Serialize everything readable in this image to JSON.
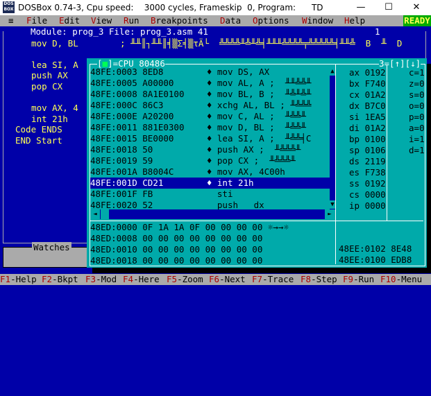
{
  "window": {
    "title": "DOSBox 0.74-3, Cpu speed:    3000 cycles, Frameskip  0, Program:      TD",
    "icon_text": "DOS BOX",
    "minimize": "—",
    "maximize": "☐",
    "close": "✕"
  },
  "menubar": {
    "system": "≡",
    "items": [
      {
        "hk": "F",
        "rest": "ile"
      },
      {
        "hk": "E",
        "rest": "dit"
      },
      {
        "hk": "V",
        "rest": "iew"
      },
      {
        "hk": "R",
        "rest": "un"
      },
      {
        "hk": "B",
        "rest": "reakpoints"
      },
      {
        "hk": "D",
        "rest": "ata"
      },
      {
        "hk": "O",
        "rest": "ptions"
      },
      {
        "hk": "W",
        "rest": "indow"
      },
      {
        "hk": "H",
        "rest": "elp"
      }
    ],
    "status": "READY"
  },
  "module": {
    "title": "Module: prog_3 File: prog_3.asm 41",
    "number": "1",
    "lines": [
      "  mov D, BL        ; ╨╨║┐╨╨║╡▒Σ╡▒τÄ└  ╩╩╩╩╨╩╨╩╡╨╨╨╩╩╩╩╤╩╩╩╩╩╡╨╨╩  B  ╨  D",
      "",
      "  lea SI, A",
      "  push AX",
      "  pop CX",
      "",
      "  mov AX, 4",
      "  int 21h",
      "Code ENDS",
      "END Start"
    ]
  },
  "watches": {
    "title": "Watches"
  },
  "cpu": {
    "title": "CPU 80486",
    "close_glyph": "■",
    "window_number": "3",
    "resize_glyphs": "=[↑][↓]",
    "disasm": [
      {
        "addr": "48FE:0003",
        "bytes": "8ED8",
        "instr": "mov DS, AX"
      },
      {
        "addr": "48FE:0005",
        "bytes": "A00000",
        "instr": "mov AL, A ;  ╨╨╩╩╨"
      },
      {
        "addr": "48FE:0008",
        "bytes": "8A1E0100",
        "instr": "mov BL, B ;  ╨╩╨╩╨"
      },
      {
        "addr": "48FE:000C",
        "bytes": "86C3",
        "instr": "xchg AL, BL ; ╨╩╩╩"
      },
      {
        "addr": "48FE:000E",
        "bytes": "A20200",
        "instr": "mov C, AL ;  ╨╩╩╨"
      },
      {
        "addr": "48FE:0011",
        "bytes": "881E0300",
        "instr": "mov D, BL ;  ╨╩╩╨"
      },
      {
        "addr": "48FE:0015",
        "bytes": "BE0000",
        "instr": "lea SI, A ;  ╨╩╩╡C"
      },
      {
        "addr": "48FE:0018",
        "bytes": "50",
        "instr": "push AX ;  ╨╩╩╩╨"
      },
      {
        "addr": "48FE:0019",
        "bytes": "59",
        "instr": "pop CX ;  ╨╩╩╩╨"
      },
      {
        "addr": "48FE:001A",
        "bytes": "B8004C",
        "instr": "mov AX, 4C00h"
      },
      {
        "addr": "48FE:001D",
        "bytes": "CD21",
        "instr": "int 21h",
        "selected": true
      },
      {
        "addr": "48FE:001F",
        "bytes": "FB",
        "instr": "sti",
        "plain": true
      },
      {
        "addr": "48FE:0020",
        "bytes": "52",
        "instr": "push   dx",
        "plain": true
      }
    ],
    "registers": [
      {
        "name": "ax",
        "value": "0192"
      },
      {
        "name": "bx",
        "value": "F740"
      },
      {
        "name": "cx",
        "value": "01A2"
      },
      {
        "name": "dx",
        "value": "B7C0"
      },
      {
        "name": "si",
        "value": "1EA5"
      },
      {
        "name": "di",
        "value": "01A2"
      },
      {
        "name": "bp",
        "value": "0100"
      },
      {
        "name": "sp",
        "value": "0106"
      },
      {
        "name": "ds",
        "value": "2119"
      },
      {
        "name": "es",
        "value": "F738"
      },
      {
        "name": "ss",
        "value": "0192"
      },
      {
        "name": "cs",
        "value": "0000"
      },
      {
        "name": "ip",
        "value": "0000"
      }
    ],
    "flags": [
      {
        "name": "c",
        "value": "1"
      },
      {
        "name": "z",
        "value": "0"
      },
      {
        "name": "s",
        "value": "0"
      },
      {
        "name": "o",
        "value": "0"
      },
      {
        "name": "p",
        "value": "0"
      },
      {
        "name": "a",
        "value": "0"
      },
      {
        "name": "i",
        "value": "1"
      },
      {
        "name": "d",
        "value": "1"
      }
    ],
    "dump": [
      "48ED:0000 0F 1A 1A 0F 00 00 00 00 ☼→→☼",
      "48ED:0008 00 00 00 00 00 00 00 00",
      "48ED:0010 00 00 00 00 00 00 00 00",
      "48ED:0018 00 00 00 00 00 00 00 00"
    ],
    "stack": [
      "48EE:0102 8E48",
      "48EE:0100 EDB8"
    ]
  },
  "fkeys": [
    {
      "k": "F1",
      "l": "-Help"
    },
    {
      "k": "F2",
      "l": "-Bkpt"
    },
    {
      "k": "F3",
      "l": "-Mod"
    },
    {
      "k": "F4",
      "l": "-Here"
    },
    {
      "k": "F5",
      "l": "-Zoom"
    },
    {
      "k": "F6",
      "l": "-Next"
    },
    {
      "k": "F7",
      "l": "-Trace"
    },
    {
      "k": "F8",
      "l": "-Step"
    },
    {
      "k": "F9",
      "l": "-Run"
    },
    {
      "k": "F10",
      "l": "-Menu"
    }
  ]
}
